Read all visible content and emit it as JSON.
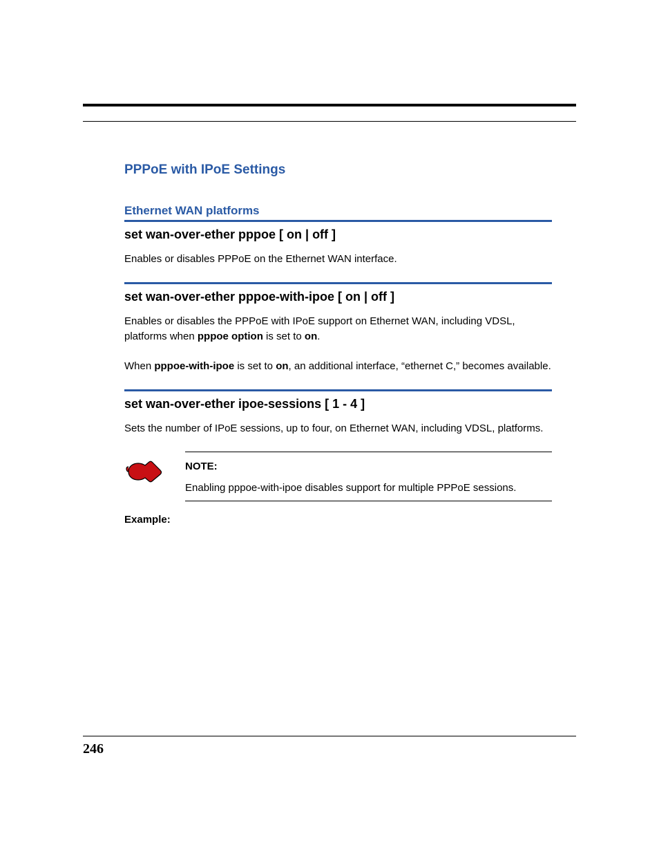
{
  "title": "PPPoE with IPoE Settings",
  "subheading": "Ethernet WAN platforms",
  "sections": [
    {
      "cmd": "set wan-over-ether pppoe [ on | off ]",
      "paras": [
        {
          "runs": [
            {
              "t": "Enables or disables PPPoE on the Ethernet WAN interface."
            }
          ]
        }
      ]
    },
    {
      "cmd": "set wan-over-ether pppoe-with-ipoe [ on | off ]",
      "paras": [
        {
          "runs": [
            {
              "t": "Enables or disables the PPPoE with IPoE support on Ethernet WAN, including VDSL, platforms when "
            },
            {
              "t": "pppoe option",
              "b": true
            },
            {
              "t": " is set to "
            },
            {
              "t": "on",
              "b": true
            },
            {
              "t": "."
            }
          ]
        },
        {
          "runs": [
            {
              "t": "When "
            },
            {
              "t": "pppoe-with-ipoe",
              "b": true
            },
            {
              "t": " is set to "
            },
            {
              "t": "on",
              "b": true
            },
            {
              "t": ", an additional interface, “ethernet C,” becomes available."
            }
          ]
        }
      ]
    },
    {
      "cmd": "set wan-over-ether ipoe-sessions [ 1 - 4 ]",
      "paras": [
        {
          "runs": [
            {
              "t": "Sets the number of IPoE sessions, up to four, on Ethernet WAN, including VDSL, platforms."
            }
          ]
        }
      ]
    }
  ],
  "note": {
    "label": "NOTE:",
    "body": "Enabling pppoe-with-ipoe disables support for multiple PPPoE sessions."
  },
  "example_label": "Example:",
  "page_number": "246",
  "icon_color": "#c81014"
}
